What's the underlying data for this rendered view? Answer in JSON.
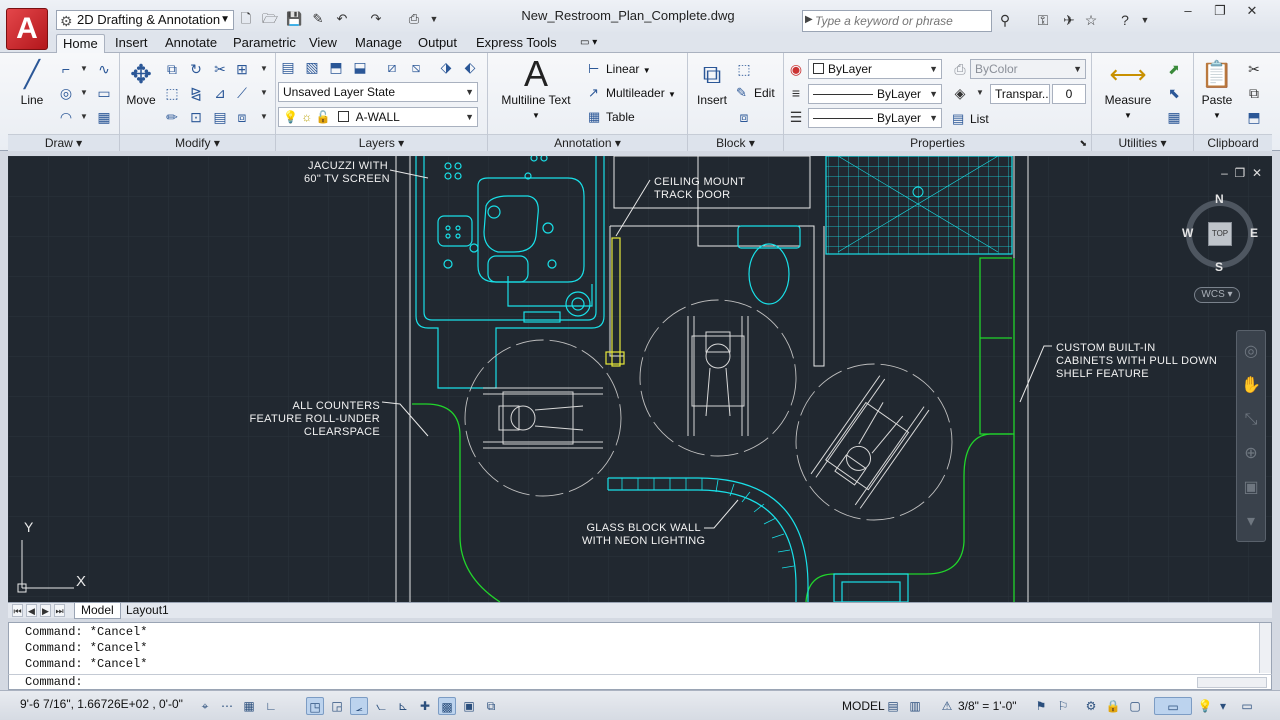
{
  "app": {
    "logo_letter": "A",
    "workspace": "2D Drafting & Annotation",
    "document_title": "New_Restroom_Plan_Complete.dwg",
    "search_placeholder": "Type a keyword or phrase",
    "window_buttons": [
      "–",
      "❐",
      "✕"
    ]
  },
  "tabs": [
    "Home",
    "Insert",
    "Annotate",
    "Parametric",
    "View",
    "Manage",
    "Output",
    "Express Tools"
  ],
  "active_tab": "Home",
  "ribbon": {
    "draw": {
      "title": "Draw",
      "line_label": "Line"
    },
    "modify": {
      "title": "Modify",
      "move_label": "Move"
    },
    "layers": {
      "title": "Layers",
      "layer_state": "Unsaved Layer State",
      "current_layer": "A-WALL"
    },
    "annotation": {
      "title": "Annotation",
      "mtext_label": "Multiline Text",
      "linear_label": "Linear",
      "multileader_label": "Multileader",
      "table_label": "Table"
    },
    "block": {
      "title": "Block",
      "insert_label": "Insert",
      "edit_label": "Edit"
    },
    "properties": {
      "title": "Properties",
      "color": "ByLayer",
      "linetype": "ByLayer",
      "lineweight": "ByLayer",
      "plotstyle": "ByColor",
      "transparency_label": "Transpar...",
      "transparency_value": "0",
      "list_label": "List"
    },
    "utilities": {
      "title": "Utilities",
      "measure_label": "Measure"
    },
    "clipboard": {
      "title": "Clipboard",
      "paste_label": "Paste"
    }
  },
  "drawing": {
    "notes": {
      "jacuzzi": [
        "JACUZZI WITH",
        "60\" TV SCREEN"
      ],
      "ceiling": [
        "CEILING MOUNT",
        "TRACK DOOR"
      ],
      "counters": [
        "ALL COUNTERS",
        "FEATURE ROLL-UNDER",
        "CLEARSPACE"
      ],
      "cabinets": [
        "CUSTOM BUILT-IN",
        "CABINETS WITH PULL DOWN",
        "SHELF FEATURE"
      ],
      "glass": [
        "GLASS BLOCK WALL",
        "WITH NEON LIGHTING"
      ]
    },
    "ucs_x": "X",
    "ucs_y": "Y",
    "viewcube": {
      "n": "N",
      "s": "S",
      "e": "E",
      "w": "W",
      "top": "TOP"
    },
    "wcs": "WCS",
    "colors": {
      "background": "#212830",
      "cyan": "#19e0e8",
      "green": "#21d52b",
      "white": "#e8e8e8",
      "yellow": "#e8e83a"
    }
  },
  "layout_tabs": {
    "model": "Model",
    "layout1": "Layout1"
  },
  "command": {
    "history": [
      "Command: *Cancel*",
      "Command: *Cancel*",
      "Command: *Cancel*"
    ],
    "prompt": "Command:"
  },
  "status": {
    "coordinates": "9'-6 7/16\", 1.66726E+02 , 0'-0\"",
    "space": "MODEL",
    "scale": "3/8\" = 1'-0\""
  }
}
